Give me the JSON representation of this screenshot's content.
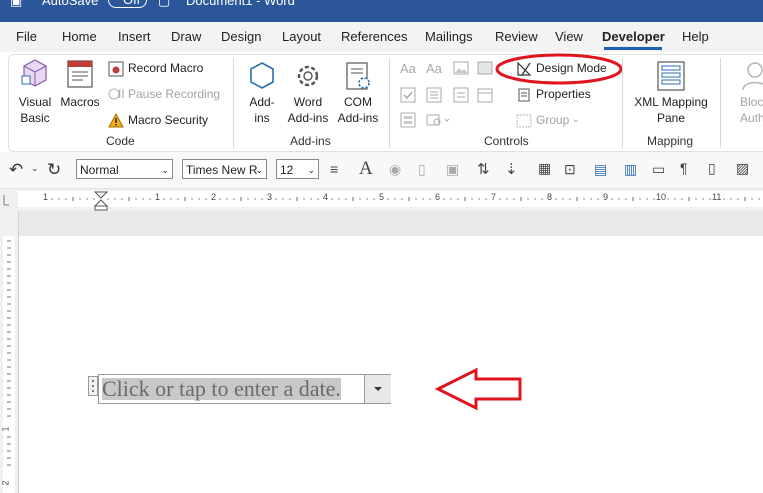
{
  "title_bar": {
    "autosave": "AutoSave",
    "toggle": "Off",
    "doc_title": "Document1 - Word"
  },
  "tabs": [
    "File",
    "Home",
    "Insert",
    "Draw",
    "Design",
    "Layout",
    "References",
    "Mailings",
    "Review",
    "View",
    "Developer",
    "Help"
  ],
  "active_tab": "Developer",
  "ribbon": {
    "code": {
      "visual_basic": [
        "Visual",
        "Basic"
      ],
      "macros": "Macros",
      "record_macro": "Record Macro",
      "pause_recording": "II Pause Recording",
      "macro_security": "Macro Security",
      "label": "Code"
    },
    "addins": {
      "addins_btn": [
        "Add-",
        "ins"
      ],
      "word_addins": [
        "Word",
        "Add-ins"
      ],
      "com_addins": [
        "COM",
        "Add-ins"
      ],
      "label": "Add-ins"
    },
    "controls": {
      "design_mode": "Design Mode",
      "properties": "Properties",
      "group": "Group",
      "label": "Controls"
    },
    "mapping": {
      "xml_mapping": [
        "XML Mapping",
        "Pane"
      ],
      "label": "Mapping"
    },
    "protect": {
      "block_authors": [
        "Bloc",
        "Autho"
      ]
    }
  },
  "qat": {
    "style": "Normal",
    "font": "Times New R",
    "size": "12"
  },
  "ruler_numbers": [
    "1",
    "1",
    "2",
    "3",
    "4",
    "5",
    "6",
    "7",
    "8",
    "9",
    "10",
    "11"
  ],
  "vruler_numbers": [
    "1",
    "2"
  ],
  "document": {
    "date_placeholder": "Click or tap to enter a date."
  },
  "colors": {
    "accent": "#2b579a",
    "annotation": "#e0141e"
  }
}
